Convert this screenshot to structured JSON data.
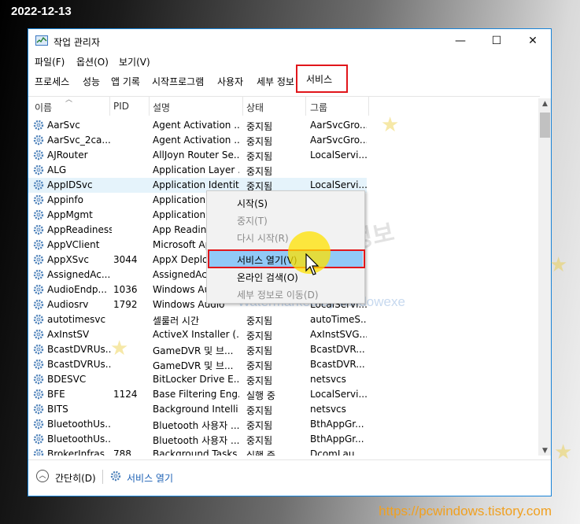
{
  "overlay": {
    "date": "2022-12-13",
    "site_url": "https://pcwindows.tistory.com",
    "watermark_bottom": "Watermarked by WindowexeWatermark",
    "watermark_mid": "Watermarked by windowexe",
    "watermark_korean": "컴퓨터 관련 정보"
  },
  "window": {
    "title": "작업 관리자",
    "minimize": "—",
    "maximize": "☐",
    "close": "✕"
  },
  "menu": [
    "파일(F)",
    "옵션(O)",
    "보기(V)"
  ],
  "tabs": [
    "프로세스",
    "성능",
    "앱 기록",
    "시작프로그램",
    "사용자",
    "세부 정보",
    "서비스"
  ],
  "active_tab": "서비스",
  "columns": {
    "name": "이름",
    "pid": "PID",
    "desc": "설명",
    "state": "상태",
    "group": "그룹"
  },
  "services": [
    {
      "name": "AarSvc",
      "pid": "",
      "desc": "Agent Activation ...",
      "state": "중지됨",
      "group": "AarSvcGro..."
    },
    {
      "name": "AarSvc_2ca...",
      "pid": "",
      "desc": "Agent Activation ...",
      "state": "중지됨",
      "group": "AarSvcGro..."
    },
    {
      "name": "AJRouter",
      "pid": "",
      "desc": "AllJoyn Router Se...",
      "state": "중지됨",
      "group": "LocalServi..."
    },
    {
      "name": "ALG",
      "pid": "",
      "desc": "Application Layer ...",
      "state": "중지됨",
      "group": ""
    },
    {
      "name": "AppIDSvc",
      "pid": "",
      "desc": "Application Identity",
      "state": "중지됨",
      "group": "LocalServi..."
    },
    {
      "name": "Appinfo",
      "pid": "",
      "desc": "Application In",
      "state": "",
      "group": ""
    },
    {
      "name": "AppMgmt",
      "pid": "",
      "desc": "Application M",
      "state": "",
      "group": ""
    },
    {
      "name": "AppReadiness",
      "pid": "",
      "desc": "App Readines",
      "state": "",
      "group": ""
    },
    {
      "name": "AppVClient",
      "pid": "",
      "desc": "Microsoft Ap",
      "state": "",
      "group": ""
    },
    {
      "name": "AppXSvc",
      "pid": "3044",
      "desc": "AppX Deploy",
      "state": "",
      "group": ""
    },
    {
      "name": "AssignedAc...",
      "pid": "",
      "desc": "AssignedAcce",
      "state": "",
      "group": ""
    },
    {
      "name": "AudioEndp...",
      "pid": "1036",
      "desc": "Windows Aud",
      "state": "",
      "group": ""
    },
    {
      "name": "Audiosrv",
      "pid": "1792",
      "desc": "Windows Audio",
      "state": "",
      "group": "LocalServi..."
    },
    {
      "name": "autotimesvc",
      "pid": "",
      "desc": "셀룰러 시간",
      "state": "중지됨",
      "group": "autoTimeS..."
    },
    {
      "name": "AxInstSV",
      "pid": "",
      "desc": "ActiveX Installer (...",
      "state": "중지됨",
      "group": "AxInstSVG..."
    },
    {
      "name": "BcastDVRUs...",
      "pid": "",
      "desc": "GameDVR 및 브...",
      "state": "중지됨",
      "group": "BcastDVR..."
    },
    {
      "name": "BcastDVRUs...",
      "pid": "",
      "desc": "GameDVR 및 브...",
      "state": "중지됨",
      "group": "BcastDVR..."
    },
    {
      "name": "BDESVC",
      "pid": "",
      "desc": "BitLocker Drive E...",
      "state": "중지됨",
      "group": "netsvcs"
    },
    {
      "name": "BFE",
      "pid": "1124",
      "desc": "Base Filtering Eng...",
      "state": "실행 중",
      "group": "LocalServi..."
    },
    {
      "name": "BITS",
      "pid": "",
      "desc": "Background Intelli...",
      "state": "중지됨",
      "group": "netsvcs"
    },
    {
      "name": "BluetoothUs...",
      "pid": "",
      "desc": "Bluetooth 사용자 ...",
      "state": "중지됨",
      "group": "BthAppGr..."
    },
    {
      "name": "BluetoothUs...",
      "pid": "",
      "desc": "Bluetooth 사용자 ...",
      "state": "중지됨",
      "group": "BthAppGr..."
    },
    {
      "name": "BrokerInfras...",
      "pid": "788",
      "desc": "Background Tasks ...",
      "state": "실행 중",
      "group": "DcomLau..."
    }
  ],
  "selected_row": 4,
  "context_menu": [
    {
      "label": "시작(S)",
      "disabled": false
    },
    {
      "label": "중지(T)",
      "disabled": true
    },
    {
      "label": "다시 시작(R)",
      "disabled": true
    },
    {
      "label": "서비스 열기(V)",
      "disabled": false
    },
    {
      "label": "온라인 검색(O)",
      "disabled": false
    },
    {
      "label": "세부 정보로 이동(D)",
      "disabled": true
    }
  ],
  "footer": {
    "less_details": "간단히(D)",
    "open_services": "서비스 열기"
  },
  "colors": {
    "accent": "#1883d7",
    "highlight_box": "#e1161b",
    "menu_hover": "#91c9f7",
    "selected_row": "#e5f3fb",
    "link": "#1a5fb4"
  }
}
